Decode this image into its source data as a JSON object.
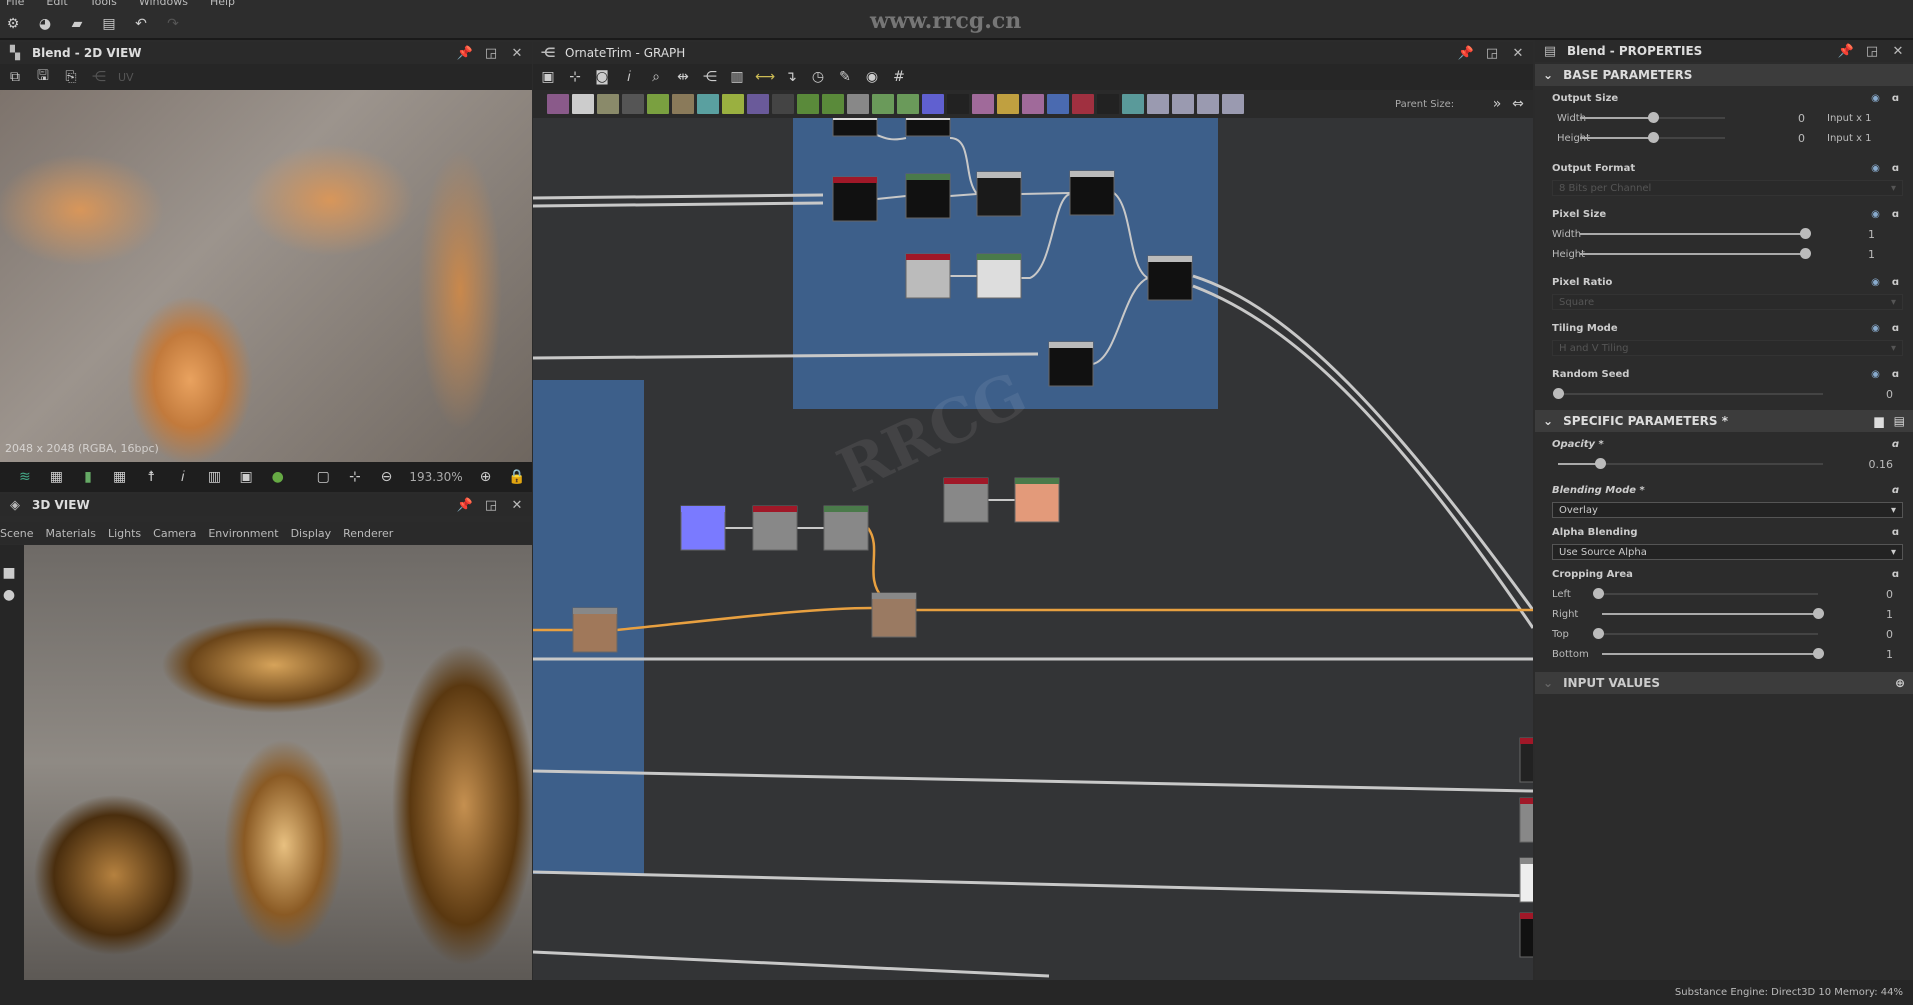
{
  "menu": [
    "File",
    "Edit",
    "Tools",
    "Windows",
    "Help"
  ],
  "view2d": {
    "title": "Blend - 2D VIEW",
    "uv_label": "UV",
    "image_info": "2048 x 2048 (RGBA, 16bpc)",
    "zoom": "193.30%"
  },
  "view3d": {
    "title": "3D VIEW",
    "menu": [
      "Scene",
      "Materials",
      "Lights",
      "Camera",
      "Environment",
      "Display",
      "Renderer"
    ]
  },
  "graph": {
    "title": "OrnateTrim - GRAPH",
    "parent_size_label": "Parent Size:",
    "toolbar_colors": [
      "#8a5a8a",
      "#ccc",
      "#8a8a6a",
      "#555",
      "#7aa040",
      "#8a7a5a",
      "#5aa0a0",
      "#9ab040",
      "#6a5a9a",
      "#444",
      "#5a8a3a",
      "#5a8a3a",
      "#888",
      "#6a9a5a",
      "#6a9a5a",
      "#6060d0",
      "#222",
      "#a06a9a",
      "#c0a040",
      "#a06a9a",
      "#4a6ab0",
      "#a03040",
      "#222",
      "#5a9a9a",
      "#9a9ab0",
      "#9a9ab0",
      "#9a9ab0",
      "#9a9ab0"
    ]
  },
  "properties": {
    "title": "Blend - PROPERTIES",
    "base_section": "BASE PARAMETERS",
    "output_size": {
      "label": "Output Size",
      "width_label": "Width",
      "width_value": "0",
      "width_suffix": "Input x 1",
      "height_label": "Height",
      "height_value": "0",
      "height_suffix": "Input x 1",
      "slider_fraction": 0.5
    },
    "output_format": {
      "label": "Output Format",
      "value": "8 Bits per Channel"
    },
    "pixel_size": {
      "label": "Pixel Size",
      "width_label": "Width",
      "width_value": "1",
      "height_label": "Height",
      "height_value": "1"
    },
    "pixel_ratio": {
      "label": "Pixel Ratio",
      "value": "Square"
    },
    "tiling_mode": {
      "label": "Tiling Mode",
      "value": "H and V Tiling"
    },
    "random_seed": {
      "label": "Random Seed",
      "value": "0"
    },
    "specific_section": "SPECIFIC PARAMETERS *",
    "opacity": {
      "label": "Opacity *",
      "value": "0.16"
    },
    "blending_mode": {
      "label": "Blending Mode *",
      "value": "Overlay"
    },
    "alpha_blending": {
      "label": "Alpha Blending",
      "value": "Use Source Alpha"
    },
    "cropping": {
      "label": "Cropping Area",
      "left_label": "Left",
      "left_value": "0",
      "right_label": "Right",
      "right_value": "1",
      "top_label": "Top",
      "top_value": "0",
      "bottom_label": "Bottom",
      "bottom_value": "1"
    },
    "input_section": "INPUT VALUES"
  },
  "status": "Substance Engine: Direct3D 10  Memory: 44%",
  "watermark": "www.rrcg.cn",
  "colors": {
    "accent_wire": "#e8a040",
    "frame": "#3d5f8a"
  }
}
